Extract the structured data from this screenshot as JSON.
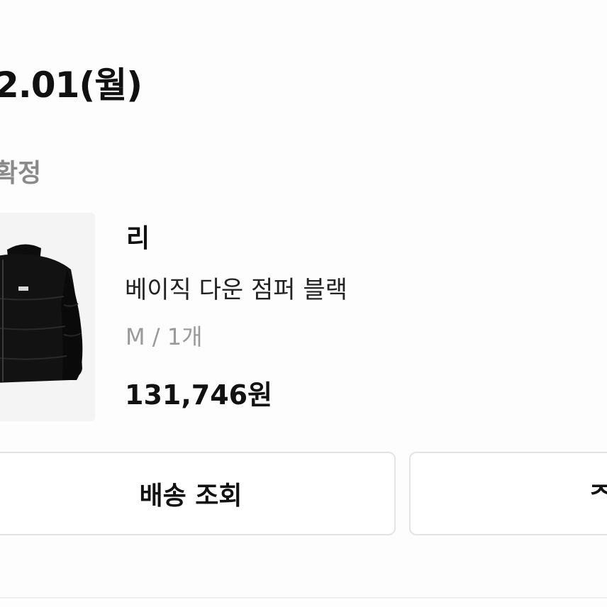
{
  "order": {
    "date": "2.01(월)",
    "status": "확정"
  },
  "item": {
    "image_icon": "black-down-jacket",
    "brand": "리",
    "name": "베이직 다운 점퍼 블랙",
    "option": "M / 1개",
    "price": "131,746원"
  },
  "actions": {
    "track_label": "배송 조회",
    "second_label": "ᄌ"
  }
}
